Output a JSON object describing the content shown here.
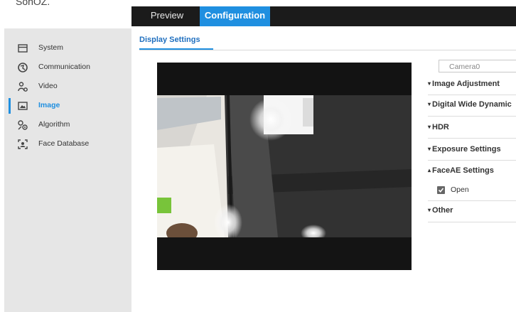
{
  "caption": "SonOZ.",
  "topnav": {
    "tabs": [
      {
        "label": "Preview"
      },
      {
        "label": "Configuration"
      }
    ]
  },
  "sidebar": {
    "items": [
      {
        "label": "System",
        "icon": "window-icon"
      },
      {
        "label": "Communication",
        "icon": "globe-icon"
      },
      {
        "label": "Video",
        "icon": "camera-user-icon"
      },
      {
        "label": "Image",
        "icon": "image-icon"
      },
      {
        "label": "Algorithm",
        "icon": "algorithm-icon"
      },
      {
        "label": "Face Database",
        "icon": "face-frame-icon"
      }
    ]
  },
  "subtab": {
    "label": "Display Settings"
  },
  "panel": {
    "camera": "Camera0",
    "sections": [
      {
        "label": "Image Adjustment",
        "expanded": false
      },
      {
        "label": "Digital Wide Dynamic",
        "expanded": false
      },
      {
        "label": "HDR",
        "expanded": false
      },
      {
        "label": "Exposure Settings",
        "expanded": false
      },
      {
        "label": "FaceAE Settings",
        "expanded": true
      },
      {
        "label": "Other",
        "expanded": false
      }
    ],
    "faceae_open": {
      "label": "Open",
      "checked": true
    }
  },
  "colors": {
    "accent": "#1f8fe0",
    "topbar": "#1b1b1b",
    "sidebar": "#e6e6e6"
  }
}
